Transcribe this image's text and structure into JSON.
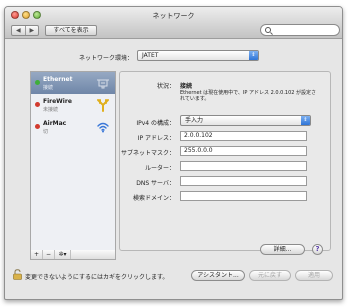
{
  "window": {
    "title": "ネットワーク"
  },
  "toolbar": {
    "back": "◀",
    "forward": "▶",
    "show_all": "すべてを表示",
    "search_placeholder": ""
  },
  "environment": {
    "label": "ネットワーク環境：",
    "value": "JATET"
  },
  "services": [
    {
      "name": "Ethernet",
      "status": "接続",
      "dot": "#3fae3a",
      "icon": "ethernet-icon"
    },
    {
      "name": "FireWire",
      "status": "未接続",
      "dot": "#d23b2f",
      "icon": "firewire-icon"
    },
    {
      "name": "AirMac",
      "status": "切",
      "dot": "#d23b2f",
      "icon": "wifi-icon"
    }
  ],
  "service_actions": {
    "add": "+",
    "remove": "−",
    "gear": "✲▾"
  },
  "detail": {
    "status_label": "状況：",
    "status_value": "接続",
    "status_desc": "Ethernet は現在使用中で、IP アドレス 2.0.0.102 が設定されています。",
    "ipv4_label": "IPv4 の構成：",
    "ipv4_value": "手入力",
    "ip_label": "IP アドレス：",
    "ip_value": "2.0.0.102",
    "mask_label": "サブネットマスク：",
    "mask_value": "255.0.0.0",
    "router_label": "ルーター：",
    "router_value": "",
    "dns_label": "DNS サーバ：",
    "dns_value": "",
    "domain_label": "検索ドメイン：",
    "domain_value": ""
  },
  "buttons": {
    "advanced": "詳細...",
    "help": "?",
    "assistant": "アシスタント...",
    "revert": "元に戻す",
    "apply": "適用"
  },
  "lock": {
    "message": "変更できないようにするにはカギをクリックします。"
  },
  "colors": {
    "accent": "#3a78d8",
    "selection": "#7a8fae"
  }
}
